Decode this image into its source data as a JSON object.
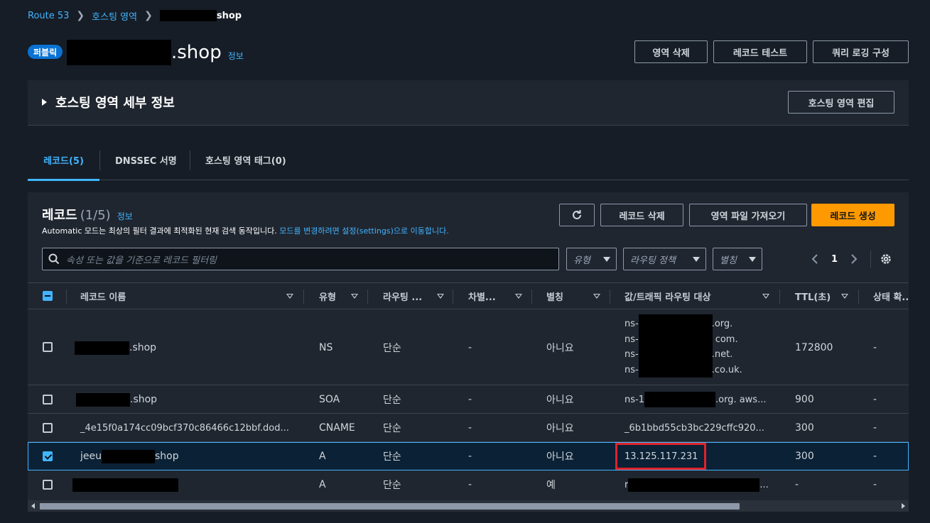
{
  "breadcrumb": {
    "root": "Route 53",
    "section": "호스팅 영역",
    "current_suffix": "shop"
  },
  "header": {
    "badge": "퍼블릭",
    "zone_suffix": ".shop",
    "info": "정보",
    "buttons": {
      "delete": "영역 삭제",
      "test": "레코드 테스트",
      "query_log": "쿼리 로깅 구성"
    }
  },
  "details": {
    "title": "호스팅 영역 세부 정보",
    "edit_button": "호스팅 영역 편집"
  },
  "tabs": [
    {
      "label": "레코드(5)",
      "active": true
    },
    {
      "label": "DNSSEC 서명",
      "active": false
    },
    {
      "label": "호스팅 영역 태그(0)",
      "active": false
    }
  ],
  "records": {
    "title": "레코드",
    "count": "(1/5)",
    "info": "정보",
    "desc_text": "Automatic 모드는 최상의 필터 결과에 최적화된 현재 검색 동작입니다.",
    "desc_link": "모드를 변경하려면 설정(settings)으로 이동합니다.",
    "buttons": {
      "delete": "레코드 삭제",
      "import": "영역 파일 가져오기",
      "create": "레코드 생성"
    },
    "search_placeholder": "속성 또는 값을 기준으로 레코드 필터링",
    "filters": [
      "유형",
      "라우팅 정책",
      "별칭"
    ],
    "page": "1"
  },
  "table": {
    "headers": [
      "레코드 이름",
      "유형",
      "라우팅 ...",
      "차별...",
      "별칭",
      "값/트래픽 라우팅 대상",
      "TTL(초)",
      "상태 확..."
    ],
    "rows": [
      {
        "name": ".shop",
        "type": "NS",
        "routing": "단순",
        "diff": "-",
        "alias": "아니요",
        "values": [
          "ns-",
          ".org.",
          "ns-",
          "com.",
          "ns-",
          ".net.",
          "ns-",
          ".co.uk."
        ],
        "ttl": "172800",
        "health": "-"
      },
      {
        "name": ".shop",
        "type": "SOA",
        "routing": "단순",
        "diff": "-",
        "alias": "아니요",
        "value_prefix": "ns-1",
        "value_suffix": ".org. aws...",
        "ttl": "900",
        "health": "-"
      },
      {
        "name": "_4e15f0a174cc09bcf370c86466c12bbf.dod...",
        "type": "CNAME",
        "routing": "단순",
        "diff": "-",
        "alias": "아니요",
        "value": "_6b1bbd55cb3bc229cffc920...",
        "ttl": "300",
        "health": "-"
      },
      {
        "name_prefix": "jeeu",
        "name_suffix": "shop",
        "type": "A",
        "routing": "단순",
        "diff": "-",
        "alias": "아니요",
        "value": "13.125.117.231",
        "ttl": "300",
        "health": "-"
      },
      {
        "type": "A",
        "routing": "단순",
        "diff": "-",
        "alias": "예",
        "value_prefix": "r",
        "value_suffix": "...",
        "ttl": "-",
        "health": "-"
      }
    ]
  },
  "colors": {
    "accent": "#42b4ff",
    "primary": "#ff9900",
    "highlight": "#e0222b"
  }
}
